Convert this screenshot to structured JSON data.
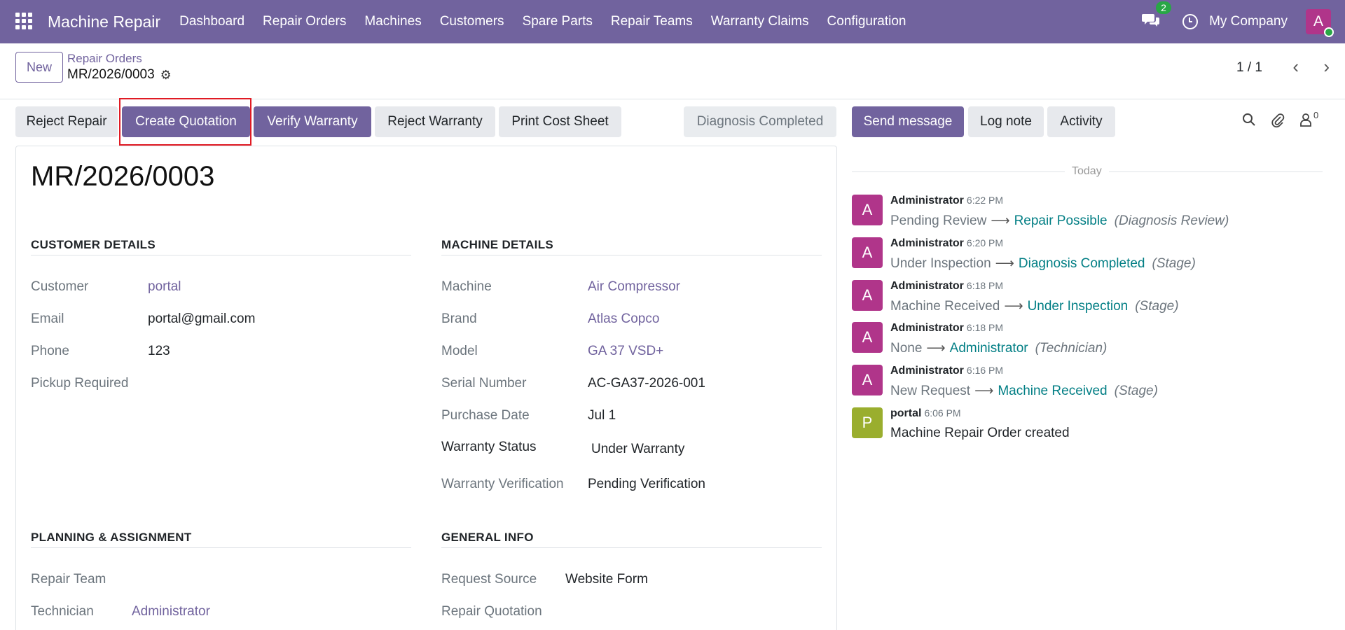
{
  "navbar": {
    "app_name": "Machine Repair",
    "menu": [
      "Dashboard",
      "Repair Orders",
      "Machines",
      "Customers",
      "Spare Parts",
      "Repair Teams",
      "Warranty Claims",
      "Configuration"
    ],
    "chat_count": "2",
    "company": "My Company",
    "user_initial": "A"
  },
  "control_panel": {
    "new_label": "New",
    "breadcrumb_parent": "Repair Orders",
    "breadcrumb_current": "MR/2026/0003",
    "pager": "1 / 1"
  },
  "actions": {
    "reject_repair": "Reject Repair",
    "create_quotation": "Create Quotation",
    "verify_warranty": "Verify Warranty",
    "reject_warranty": "Reject Warranty",
    "print_cost_sheet": "Print Cost Sheet",
    "stage": "Diagnosis Completed"
  },
  "form": {
    "title": "MR/2026/0003",
    "customer_section": {
      "title": "CUSTOMER DETAILS",
      "customer_label": "Customer",
      "customer": "portal",
      "email_label": "Email",
      "email": "portal@gmail.com",
      "phone_label": "Phone",
      "phone": "123",
      "pickup_label": "Pickup Required"
    },
    "machine_section": {
      "title": "MACHINE DETAILS",
      "machine_label": "Machine",
      "machine": "Air Compressor",
      "brand_label": "Brand",
      "brand": "Atlas Copco",
      "model_label": "Model",
      "model": "GA 37 VSD+",
      "serial_label": "Serial Number",
      "serial": "AC-GA37-2026-001",
      "purchase_label": "Purchase Date",
      "purchase": "Jul 1",
      "warranty_status_label": "Warranty Status",
      "warranty_status": "Under Warranty",
      "warranty_verif_label": "Warranty Verification",
      "warranty_verif": "Pending Verification"
    },
    "planning_section": {
      "title": "PLANNING & ASSIGNMENT",
      "team_label": "Repair Team",
      "technician_label": "Technician",
      "technician": "Administrator"
    },
    "general_section": {
      "title": "GENERAL INFO",
      "source_label": "Request Source",
      "source": "Website Form",
      "quotation_label": "Repair Quotation"
    }
  },
  "chatter": {
    "send_message": "Send message",
    "log_note": "Log note",
    "activity": "Activity",
    "followers_count": "0",
    "date_separator": "Today",
    "messages": [
      {
        "initial": "A",
        "author": "Administrator",
        "time": "6:22 PM",
        "old": "Pending Review",
        "new": "Repair Possible",
        "field": "(Diagnosis Review)"
      },
      {
        "initial": "A",
        "author": "Administrator",
        "time": "6:20 PM",
        "old": "Under Inspection",
        "new": "Diagnosis Completed",
        "field": "(Stage)"
      },
      {
        "initial": "A",
        "author": "Administrator",
        "time": "6:18 PM",
        "old": "Machine Received",
        "new": "Under Inspection",
        "field": "(Stage)"
      },
      {
        "initial": "A",
        "author": "Administrator",
        "time": "6:18 PM",
        "old": "None",
        "new": "Administrator",
        "field": "(Technician)"
      },
      {
        "initial": "A",
        "author": "Administrator",
        "time": "6:16 PM",
        "old": "New Request",
        "new": "Machine Received",
        "field": "(Stage)"
      },
      {
        "initial": "P",
        "author": "portal",
        "time": "6:06 PM",
        "text": "Machine Repair Order created"
      }
    ]
  },
  "colors": {
    "brand": "#71639e",
    "admin_avatar": "#b0358a",
    "portal_avatar": "#9aae2e",
    "tracking_value": "#017e84",
    "highlight": "#e01b24"
  }
}
